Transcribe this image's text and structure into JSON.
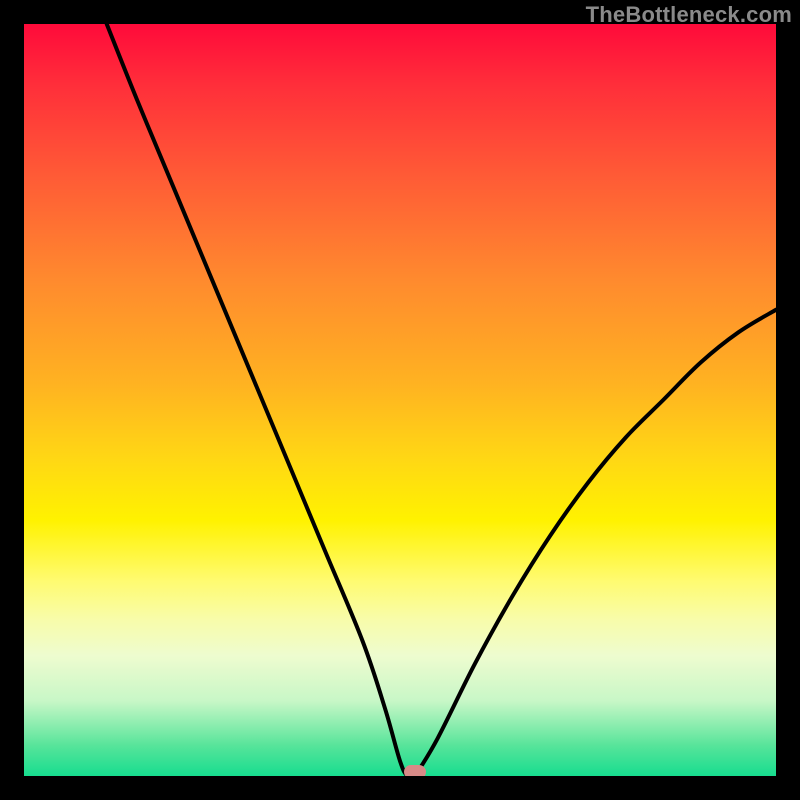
{
  "watermark": "TheBottleneck.com",
  "colors": {
    "frame": "#000000",
    "curve": "#000000",
    "marker": "#d78a87"
  },
  "chart_data": {
    "type": "line",
    "title": "",
    "xlabel": "",
    "ylabel": "",
    "xlim": [
      0,
      100
    ],
    "ylim": [
      0,
      100
    ],
    "grid": false,
    "legend": false,
    "annotations": [
      {
        "type": "marker",
        "x": 52,
        "y": 0
      }
    ],
    "series": [
      {
        "name": "left-branch",
        "x": [
          11,
          15,
          20,
          25,
          30,
          35,
          40,
          45,
          48,
          50,
          51,
          52
        ],
        "y": [
          100,
          90,
          78,
          66,
          54,
          42,
          30,
          18,
          9,
          2,
          0,
          0
        ]
      },
      {
        "name": "right-branch",
        "x": [
          52,
          55,
          60,
          65,
          70,
          75,
          80,
          85,
          90,
          95,
          100
        ],
        "y": [
          0,
          5,
          15,
          24,
          32,
          39,
          45,
          50,
          55,
          59,
          62
        ]
      }
    ],
    "background_gradient_stops": [
      {
        "pos": 0,
        "color": "#ff0a3a"
      },
      {
        "pos": 8,
        "color": "#ff2e3a"
      },
      {
        "pos": 20,
        "color": "#ff5a36"
      },
      {
        "pos": 34,
        "color": "#ff8a2e"
      },
      {
        "pos": 48,
        "color": "#ffb321"
      },
      {
        "pos": 58,
        "color": "#ffd814"
      },
      {
        "pos": 66,
        "color": "#fff200"
      },
      {
        "pos": 74,
        "color": "#fffb70"
      },
      {
        "pos": 79,
        "color": "#f8fca8"
      },
      {
        "pos": 84,
        "color": "#eefccf"
      },
      {
        "pos": 90,
        "color": "#c8f7c7"
      },
      {
        "pos": 96,
        "color": "#56e49a"
      },
      {
        "pos": 100,
        "color": "#17dd8f"
      }
    ]
  }
}
